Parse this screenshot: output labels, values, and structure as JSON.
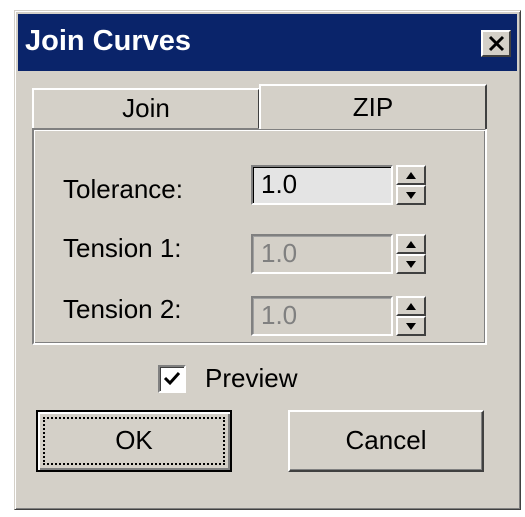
{
  "window": {
    "title": "Join Curves"
  },
  "tabs": [
    {
      "label": "Join"
    },
    {
      "label": "ZIP"
    }
  ],
  "fields": {
    "tolerance": {
      "label": "Tolerance:",
      "value": "1.0",
      "enabled": true
    },
    "tension1": {
      "label": "Tension 1:",
      "value": "1.0",
      "enabled": false
    },
    "tension2": {
      "label": "Tension 2:",
      "value": "1.0",
      "enabled": false
    }
  },
  "preview": {
    "label": "Preview",
    "checked": true
  },
  "buttons": {
    "ok": "OK",
    "cancel": "Cancel"
  },
  "colors": {
    "titlebar": "#0a246a",
    "face": "#d4d0c8"
  }
}
